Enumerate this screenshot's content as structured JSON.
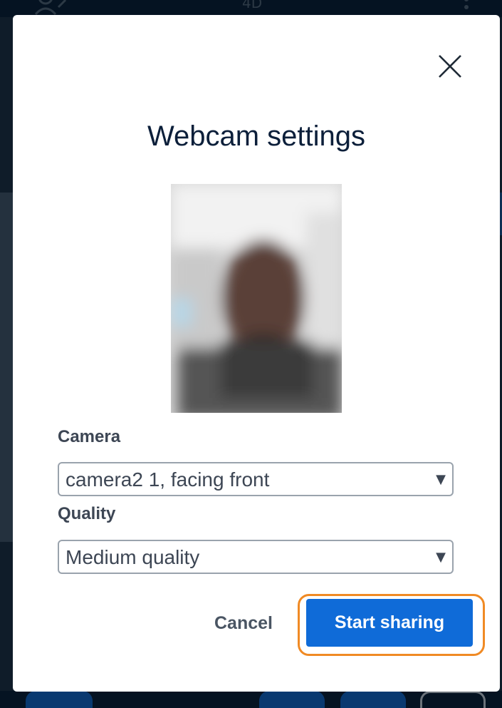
{
  "background": {
    "top_title": "4D"
  },
  "modal": {
    "title": "Webcam settings",
    "camera": {
      "label": "Camera",
      "selected": "camera2 1, facing front"
    },
    "quality": {
      "label": "Quality",
      "selected": "Medium quality"
    },
    "actions": {
      "cancel_label": "Cancel",
      "start_label": "Start sharing"
    }
  },
  "colors": {
    "primary": "#0f6bd8",
    "highlight_outline": "#f08a24",
    "title_text": "#0c1f3a",
    "label_text": "#3d4654"
  },
  "icons": {
    "close": "close-icon",
    "dropdown": "chevron-down-icon",
    "users": "users-icon",
    "more": "more-vertical-icon"
  }
}
